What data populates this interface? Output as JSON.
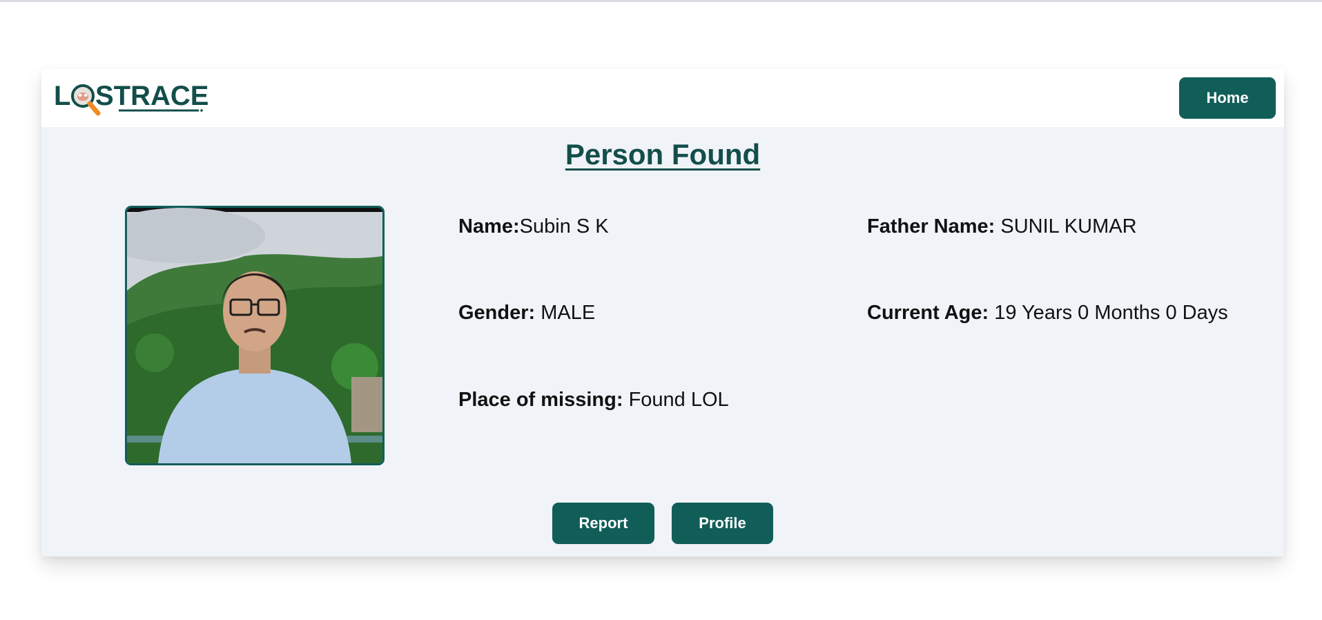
{
  "brand": {
    "logo_text_left": "L",
    "logo_text_right": "STRACE"
  },
  "nav": {
    "home_label": "Home"
  },
  "page": {
    "title": "Person Found"
  },
  "person": {
    "name_label": "Name:",
    "name_value": "Subin S K",
    "father_label": "Father Name:",
    "father_value": " SUNIL KUMAR",
    "gender_label": "Gender:",
    "gender_value": " MALE",
    "age_label": "Current Age:",
    "age_value": " 19 Years 0 Months 0 Days",
    "place_label": "Place of missing:",
    "place_value": " Found LOL"
  },
  "actions": {
    "report_label": "Report",
    "profile_label": "Profile"
  },
  "colors": {
    "brand_teal": "#115e59",
    "title_teal": "#134e4a",
    "card_bg": "#f0f3f7"
  }
}
